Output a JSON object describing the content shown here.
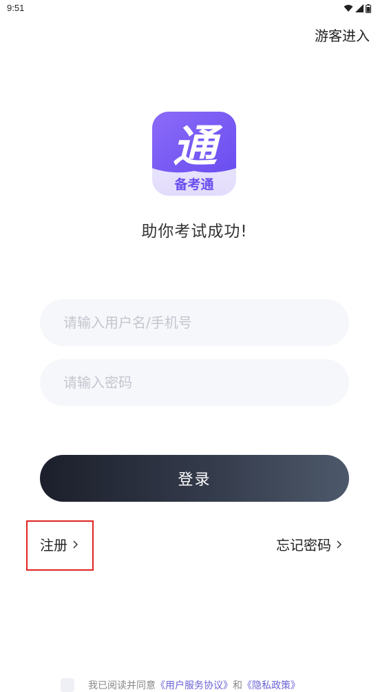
{
  "status_bar": {
    "time": "9:51",
    "icons": [
      "wifi-icon",
      "signal-icon",
      "battery-icon"
    ]
  },
  "header": {
    "guest_label": "游客进入"
  },
  "logo": {
    "main_glyph": "通",
    "sub_text": "备考通",
    "color_top": "#7a5cf5",
    "color_bottom": "#ebe6ff"
  },
  "slogan": "助你考试成功!",
  "form": {
    "username_placeholder": "请输入用户名/手机号",
    "username_value": "",
    "password_placeholder": "请输入密码",
    "password_value": "",
    "login_label": "登录"
  },
  "links": {
    "register_label": "注册",
    "forgot_label": "忘记密码"
  },
  "agreement": {
    "checked": false,
    "prefix": "我已阅读并同意",
    "service_link": "《用户服务协议》",
    "conjunction": "和",
    "privacy_link": "《隐私政策》"
  },
  "colors": {
    "accent": "#6b63d6",
    "highlight": "#e02222",
    "button_dark": "#1c1f2b",
    "button_light": "#4d596b",
    "input_bg": "#f6f7fb"
  }
}
